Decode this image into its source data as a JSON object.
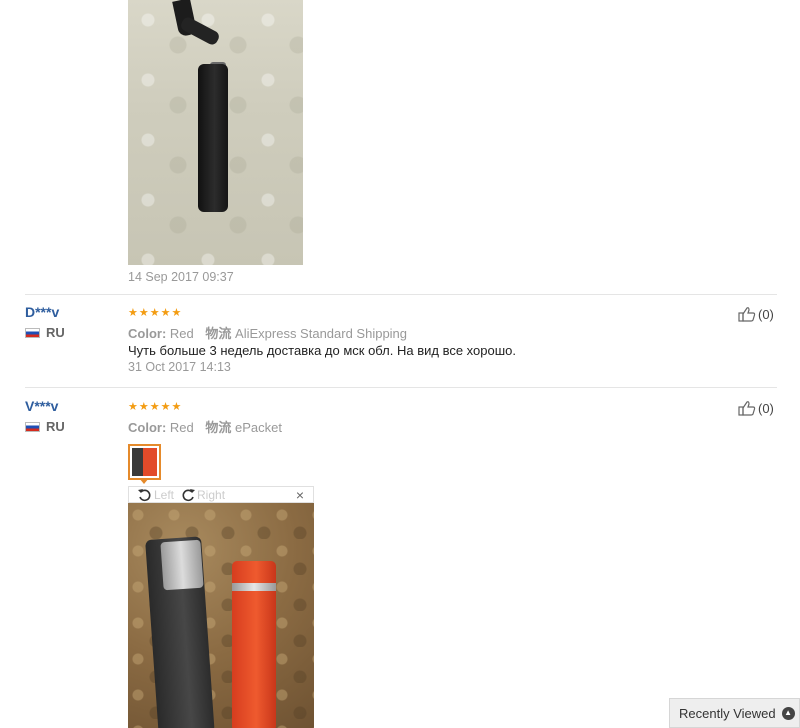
{
  "top_review": {
    "date": "14 Sep 2017 09:37"
  },
  "reviews": [
    {
      "user": "D***v",
      "country": "RU",
      "stars": 5,
      "color_label": "Color:",
      "color_value": "Red",
      "ship_label": "物流",
      "ship_value": "AliExpress Standard Shipping",
      "text": "Чуть больше 3 недель доставка до мск обл. На вид все хорошо.",
      "date": "31 Oct 2017 14:13",
      "likes": "(0)"
    },
    {
      "user": "V***v",
      "country": "RU",
      "stars": 5,
      "color_label": "Color:",
      "color_value": "Red",
      "ship_label": "物流",
      "ship_value": "ePacket",
      "likes": "(0)",
      "rotate_left": "Left",
      "rotate_right": "Right",
      "close": "×"
    }
  ],
  "recently_viewed": {
    "label": "Recently Viewed"
  },
  "colors": {
    "link_blue": "#2e5d9e",
    "star_orange": "#f39c12",
    "thumb_border": "#e58a2b"
  }
}
